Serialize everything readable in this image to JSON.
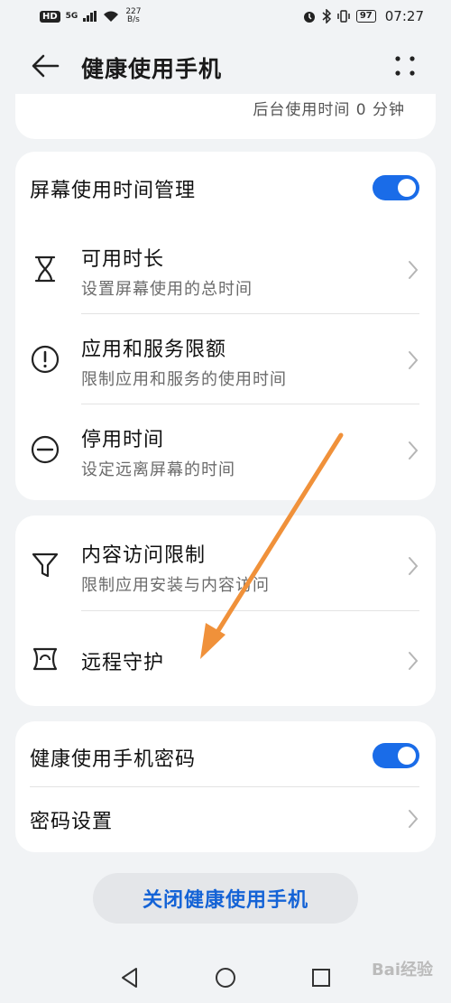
{
  "status_bar": {
    "hd": "HD",
    "signal": "5G",
    "speed_value": "227",
    "speed_unit": "B/s",
    "battery": "97",
    "time": "07:27"
  },
  "header": {
    "title": "健康使用手机",
    "back_icon": "arrow-left-icon",
    "more_icon": "more-dots-icon"
  },
  "top_card": {
    "background_time": "后台使用时间 0 分钟"
  },
  "screen_time_card": {
    "toggle_label": "屏幕使用时间管理",
    "toggle_on": true,
    "items": [
      {
        "icon": "hourglass-icon",
        "title": "可用时长",
        "subtitle": "设置屏幕使用的总时间"
      },
      {
        "icon": "exclamation-circle-icon",
        "title": "应用和服务限额",
        "subtitle": "限制应用和服务的使用时间"
      },
      {
        "icon": "minus-circle-icon",
        "title": "停用时间",
        "subtitle": "设定远离屏幕的时间"
      }
    ]
  },
  "restriction_card": {
    "items": [
      {
        "icon": "filter-icon",
        "title": "内容访问限制",
        "subtitle": "限制应用安装与内容访问"
      },
      {
        "icon": "remote-guard-icon",
        "title": "远程守护"
      }
    ]
  },
  "password_card": {
    "toggle_label": "健康使用手机密码",
    "toggle_on": true,
    "settings_label": "密码设置"
  },
  "close_button": "关闭健康使用手机",
  "nav": {
    "back_icon": "nav-back-triangle-icon",
    "home_icon": "nav-home-circle-icon",
    "recents_icon": "nav-recents-square-icon"
  },
  "watermark": "Bai经验",
  "colors": {
    "accent": "#1a6ce8",
    "close_text": "#1463d6",
    "arrow": "#f0913a",
    "background": "#f1f3f5"
  }
}
